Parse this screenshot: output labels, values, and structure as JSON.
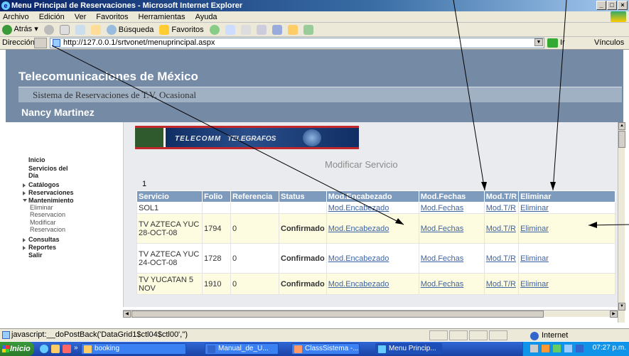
{
  "window": {
    "title": "Menu Principal de Reservaciones - Microsoft Internet Explorer",
    "controls": [
      "_",
      "□",
      "×"
    ]
  },
  "menu": [
    "Archivo",
    "Edición",
    "Ver",
    "Favoritos",
    "Herramientas",
    "Ayuda"
  ],
  "toolbar": {
    "back": "Atrás",
    "search": "Búsqueda",
    "favorites": "Favoritos"
  },
  "address": {
    "label": "Dirección",
    "url": "http://127.0.0.1/srtvonet/menuprincipal.aspx",
    "go": "Ir",
    "links": "Vínculos"
  },
  "header": {
    "title": "Telecomunicaciones de México",
    "subtitle": "Sistema de Reservaciones de T.V. Ocasional",
    "user": "Nancy Martinez"
  },
  "nav": {
    "inicio": "Inicio",
    "servicios": "Servicios del Día",
    "catalogos": "Catálogos",
    "reservaciones": "Reservaciones",
    "mantenimiento": "Mantenimiento",
    "eliminar": "Eliminar Reservacion",
    "modificar": "Modificar Reservacion",
    "consultas": "Consultas",
    "reportes": "Reportes",
    "salir": "Salir"
  },
  "banner": {
    "left": "TELECOMM",
    "right": "TELEGRAFOS"
  },
  "main": {
    "title": "Modificar Servicio",
    "page_number": "1",
    "columns": [
      "Servicio",
      "Folio",
      "Referencia",
      "Status",
      "Mod.Encabezado",
      "Mod.Fechas",
      "Mod.T/R",
      "Eliminar"
    ],
    "rows": [
      {
        "servicio": "SOL1",
        "folio": "",
        "referencia": "",
        "status": "",
        "mod_enc": "Mod.Encabezado",
        "mod_fechas": "Mod.Fechas",
        "mod_tr": "Mod.T/R",
        "eliminar": "Eliminar"
      },
      {
        "servicio": "TV AZTECA YUC 28-OCT-08",
        "folio": "1794",
        "referencia": "0",
        "status": "Confirmado",
        "mod_enc": "Mod.Encabezado",
        "mod_fechas": "Mod.Fechas",
        "mod_tr": "Mod.T/R",
        "eliminar": "Eliminar"
      },
      {
        "servicio": "TV AZTECA YUC 24-OCT-08",
        "folio": "1728",
        "referencia": "0",
        "status": "Confirmado",
        "mod_enc": "Mod.Encabezado",
        "mod_fechas": "Mod.Fechas",
        "mod_tr": "Mod.T/R",
        "eliminar": "Eliminar"
      },
      {
        "servicio": "TV YUCATAN 5 NOV",
        "folio": "1910",
        "referencia": "0",
        "status": "Confirmado",
        "mod_enc": "Mod.Encabezado",
        "mod_fechas": "Mod.Fechas",
        "mod_tr": "Mod.T/R",
        "eliminar": "Eliminar"
      }
    ]
  },
  "status": {
    "text": "javascript:__doPostBack('DataGrid1$ctl04$ctl00','')",
    "zone": "Internet"
  },
  "taskbar": {
    "start": "Inicio",
    "tasks": [
      "booking",
      "Manual_de_U...",
      "ClassSistema -...",
      "Menu Princip..."
    ],
    "clock": "07:27 p.m."
  },
  "colors": {
    "header": "#748aa5",
    "grid_header": "#7e9bbd",
    "confirmed": "#d8a21a",
    "link": "#3e64a4"
  }
}
